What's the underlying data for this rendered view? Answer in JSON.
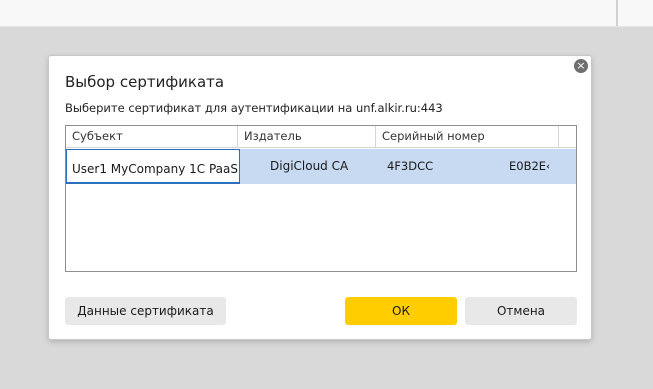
{
  "dialog": {
    "title": "Выбор сертификата",
    "subtitle": "Выберите сертификат для аутентификации на unf.alkir.ru:443",
    "close_icon": "×"
  },
  "table": {
    "columns": [
      "Субъект",
      "Издатель",
      "Серийный номер"
    ],
    "rows": [
      {
        "subject": "User1 MyCompany 1C PaaS",
        "issuer": "DigiCloud CA",
        "serial": "4F3DCC",
        "serial_tail": "E0B2E‹"
      }
    ]
  },
  "buttons": {
    "cert_data": "Данные сертификата",
    "ok": "ОК",
    "cancel": "Отмена"
  },
  "colors": {
    "accent": "#ffcd00",
    "selection": "#c8daf1",
    "focus_border": "#2c6fbd"
  }
}
